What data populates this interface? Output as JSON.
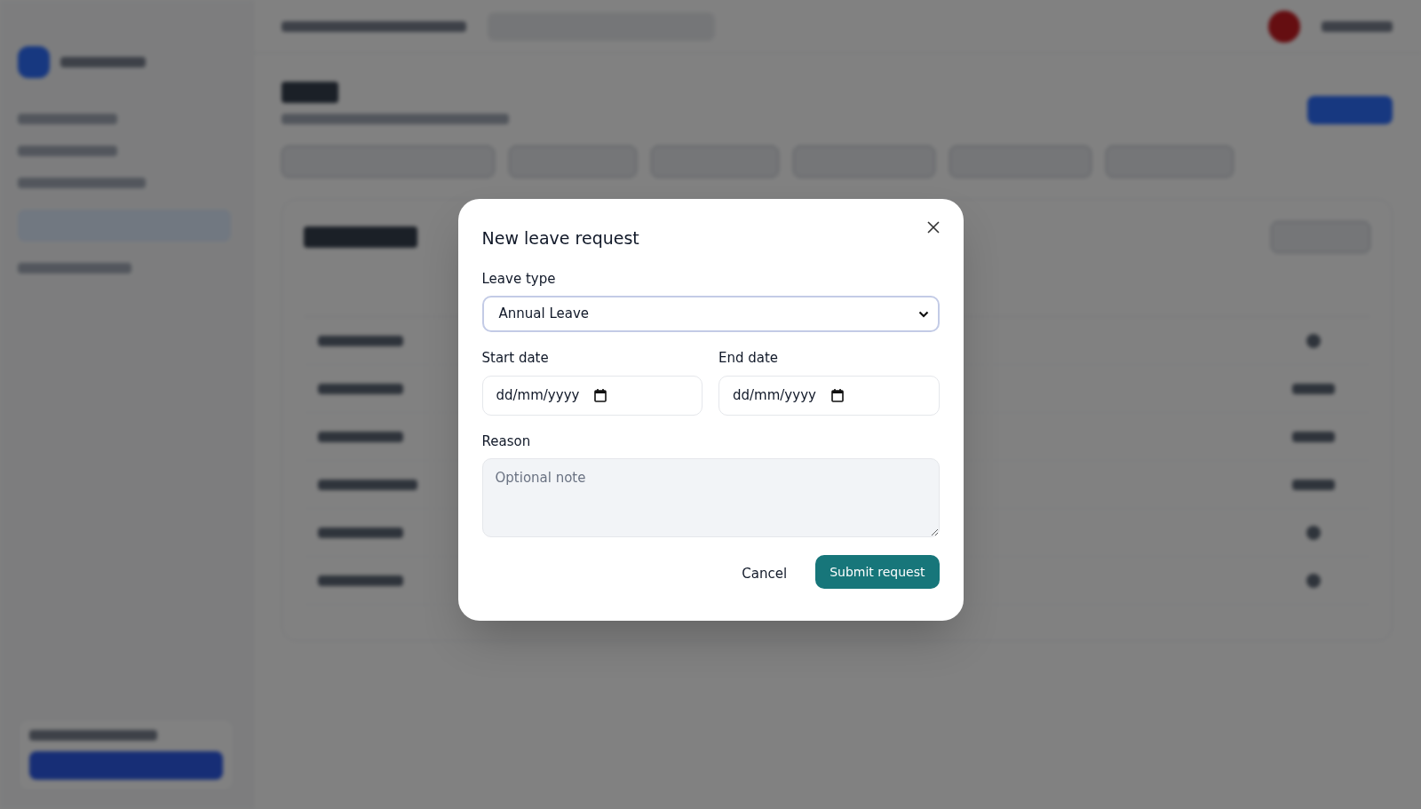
{
  "dialog": {
    "title": "New leave request",
    "fields": [
      {
        "kind": "select",
        "label": "Leave type",
        "value": "Annual Leave"
      },
      {
        "kind": "date",
        "label": "Start date",
        "value": "dd/mm/yyyy"
      },
      {
        "kind": "date",
        "label": "End date",
        "value": "dd/mm/yyyy"
      },
      {
        "kind": "textarea",
        "label": "Reason",
        "placeholder": "Optional note"
      }
    ],
    "buttons": [
      {
        "kind": "text",
        "label": "Cancel"
      },
      {
        "kind": "primary",
        "label": "Submit request"
      }
    ]
  }
}
